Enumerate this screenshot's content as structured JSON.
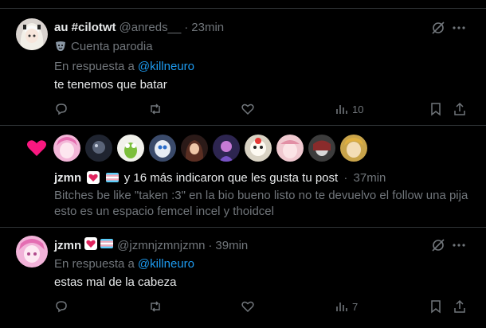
{
  "post1": {
    "display_name": "au #cilotwt",
    "handle": "@anreds__",
    "separator": "·",
    "time": "23min",
    "parody_label": "Cuenta parodia",
    "reply_prefix": "En respuesta a",
    "reply_to": "@killneuro",
    "text": "te tenemos que batar",
    "views": "10"
  },
  "likes": {
    "name": "jzmn",
    "summary": "y 16 más indicaron que les gusta tu post",
    "separator": "·",
    "time": "37min",
    "quoted_text": "Bitches be like \"taken :3\" en la bio bueno listo no te devuelvo el follow una pija esto es un espacio femcel incel y thoidcel"
  },
  "post3": {
    "display_name": "jzmn",
    "handle": "@jzmnjzmnjzmn",
    "separator": "·",
    "time": "39min",
    "reply_prefix": "En respuesta a",
    "reply_to": "@killneuro",
    "text": "estas mal de la cabeza",
    "views": "7"
  },
  "colors": {
    "background": "#000000",
    "text": "#e7e9ea",
    "muted": "#71767b",
    "link": "#1d9bf0",
    "like": "#f91880",
    "divider": "#2f3336"
  },
  "icons": [
    "grok-icon",
    "more-icon",
    "reply-icon",
    "repost-icon",
    "like-icon",
    "views-icon",
    "bookmark-icon",
    "share-icon",
    "heart-filled-icon",
    "theater-mask-icon",
    "heart-badge-icon",
    "trans-flag-icon"
  ]
}
